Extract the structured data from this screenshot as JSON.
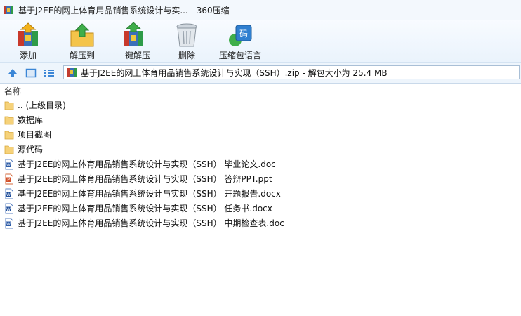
{
  "window": {
    "title": "基于J2EE的网上体育用品销售系统设计与实... - 360压缩"
  },
  "toolbar": {
    "buttons": [
      {
        "label": "添加",
        "icon": "add-archive-icon"
      },
      {
        "label": "解压到",
        "icon": "extract-to-icon"
      },
      {
        "label": "一键解压",
        "icon": "one-click-extract-icon"
      },
      {
        "label": "删除",
        "icon": "delete-trash-icon"
      },
      {
        "label": "压缩包语言",
        "icon": "archive-language-icon"
      }
    ]
  },
  "addressbar": {
    "path": "基于J2EE的网上体育用品销售系统设计与实现（SSH）.zip - 解包大小为 25.4 MB"
  },
  "filelist": {
    "header_name": "名称",
    "items": [
      {
        "name": ".. (上级目录)",
        "type": "folder"
      },
      {
        "name": "数据库",
        "type": "folder"
      },
      {
        "name": "项目截图",
        "type": "folder"
      },
      {
        "name": "源代码",
        "type": "folder"
      },
      {
        "name": "基于J2EE的网上体育用品销售系统设计与实现（SSH） 毕业论文.doc",
        "type": "doc"
      },
      {
        "name": "基于J2EE的网上体育用品销售系统设计与实现（SSH） 答辩PPT.ppt",
        "type": "ppt"
      },
      {
        "name": "基于J2EE的网上体育用品销售系统设计与实现（SSH） 开题报告.docx",
        "type": "docx"
      },
      {
        "name": "基于J2EE的网上体育用品销售系统设计与实现（SSH） 任务书.docx",
        "type": "docx"
      },
      {
        "name": "基于J2EE的网上体育用品销售系统设计与实现（SSH） 中期检查表.doc",
        "type": "doc"
      }
    ]
  }
}
